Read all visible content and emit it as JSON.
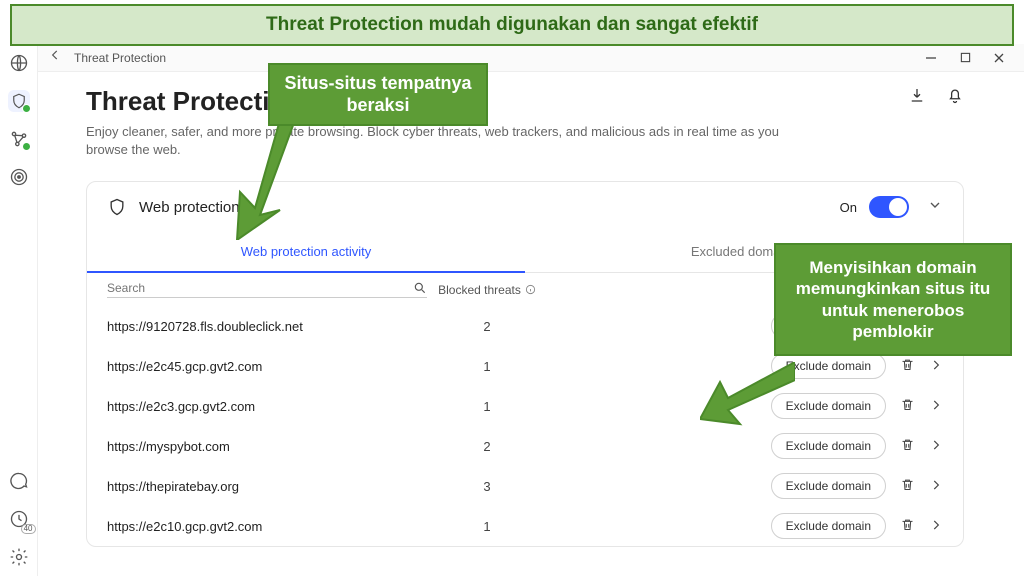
{
  "banner": {
    "text": "Threat Protection mudah digunakan dan sangat efektif"
  },
  "titlebar": {
    "title": "Threat Protection"
  },
  "page": {
    "title": "Threat Protection",
    "description": "Enjoy cleaner, safer, and more private browsing. Block cyber threats, web trackers, and malicious ads in real time as you browse the web."
  },
  "card": {
    "head_title": "Web protection",
    "on_label": "On",
    "tabs": {
      "activity": "Web protection activity",
      "excluded": "Excluded domains"
    },
    "search_placeholder": "Search",
    "blocked_threats_label": "Blocked threats",
    "exclude_label": "Exclude domain",
    "rows": [
      {
        "url": "https://9120728.fls.doubleclick.net",
        "count": 2
      },
      {
        "url": "https://e2c45.gcp.gvt2.com",
        "count": 1
      },
      {
        "url": "https://e2c3.gcp.gvt2.com",
        "count": 1
      },
      {
        "url": "https://myspybot.com",
        "count": 2
      },
      {
        "url": "https://thepiratebay.org",
        "count": 3
      },
      {
        "url": "https://e2c10.gcp.gvt2.com",
        "count": 1
      }
    ]
  },
  "callouts": {
    "c1": "Situs-situs tempatnya beraksi",
    "c2": "Menyisihkan domain memungkinkan situs itu untuk menerobos pemblokir"
  }
}
